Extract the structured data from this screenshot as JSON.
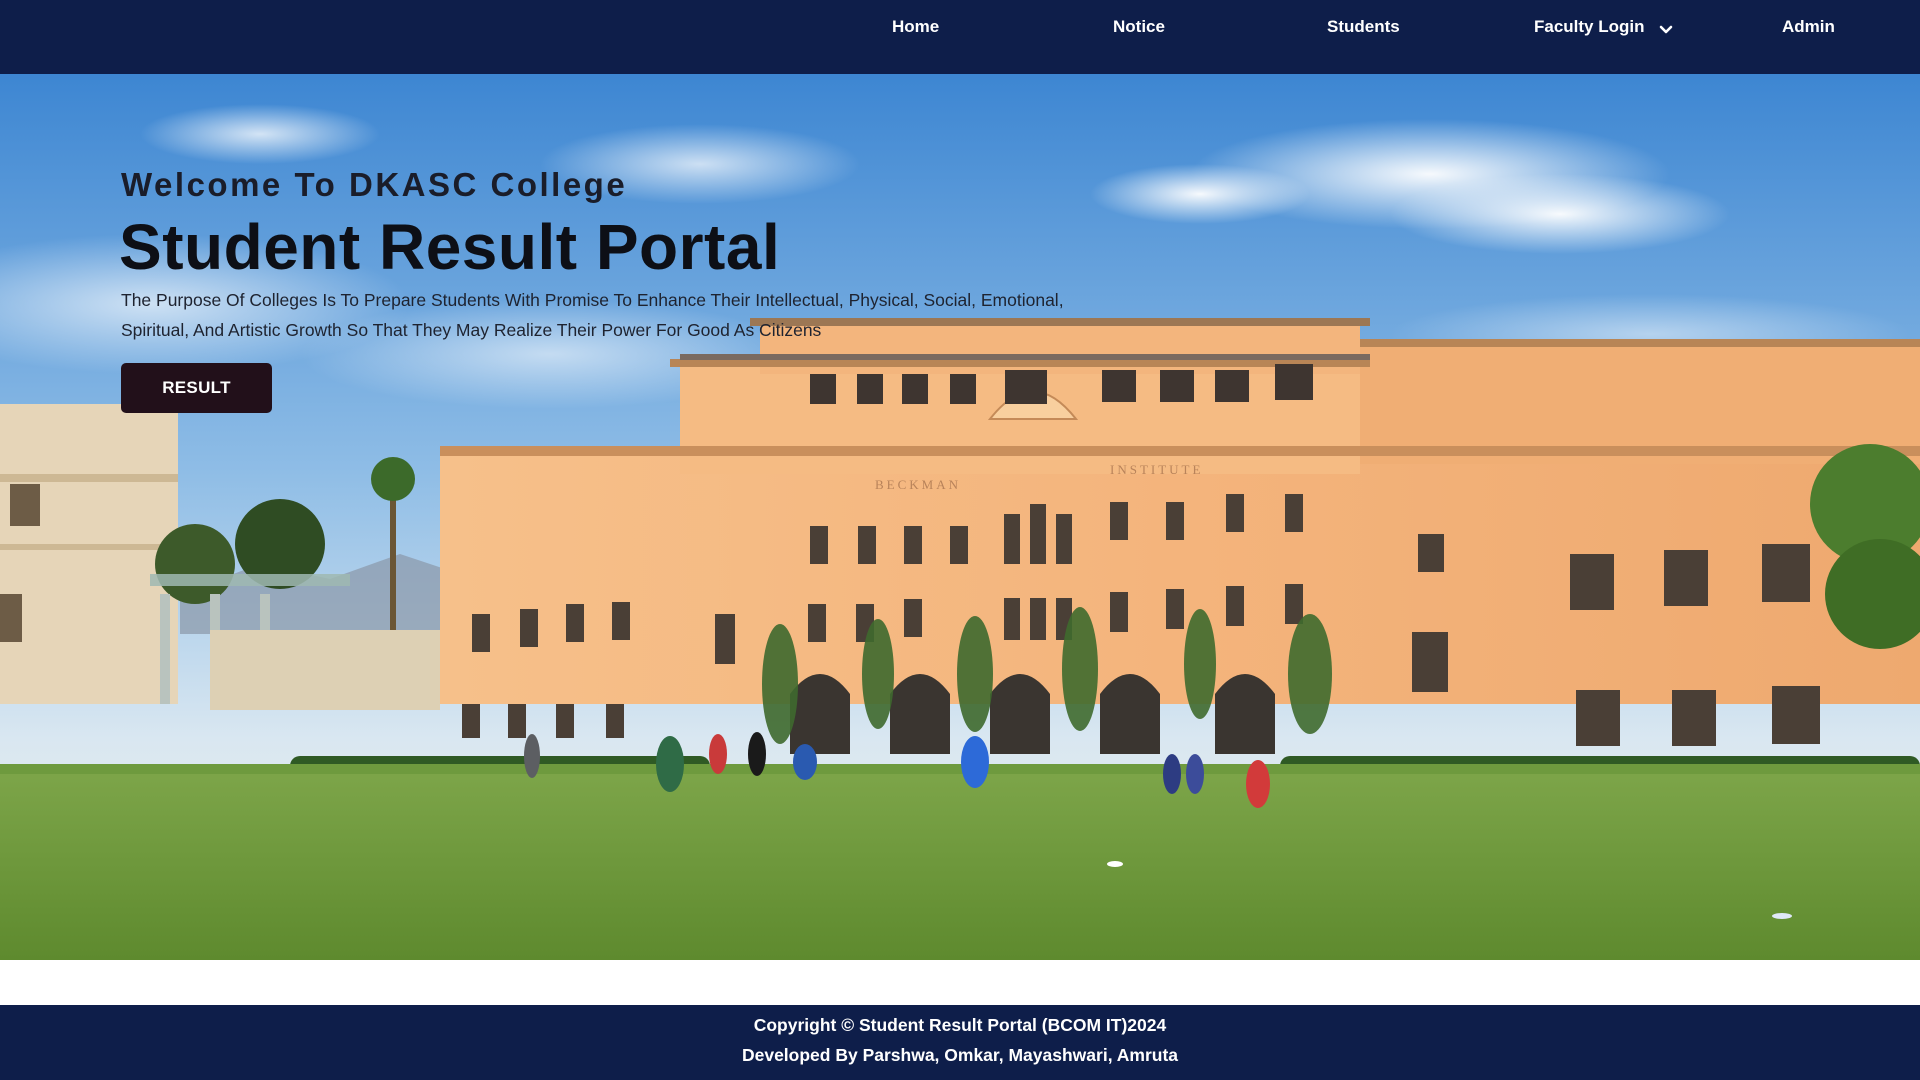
{
  "navbar": {
    "items": [
      {
        "label": "Home"
      },
      {
        "label": "Notice"
      },
      {
        "label": "Students"
      },
      {
        "label": "Faculty Login",
        "has_dropdown": true,
        "icon": "chevron-down-icon"
      },
      {
        "label": "Admin"
      }
    ]
  },
  "hero": {
    "welcome": "Welcome To DKASC College",
    "title": "Student Result Portal",
    "description": "The Purpose Of Colleges Is To Prepare Students With Promise To Enhance Their Intellectual, Physical, Social, Emotional, Spiritual, And Artistic Growth So That They May Realize Their Power For Good As Citizens",
    "button_label": "RESULT",
    "building_sign": "BECKMAN INSTITUTE"
  },
  "footer": {
    "copyright": "Copyright © Student Result Portal (BCOM IT)2024",
    "developed_by": "Developed By Parshwa, Omkar, Mayashwari, Amruta"
  },
  "colors": {
    "navbar_bg": "#0e1e4a",
    "footer_bg": "#0e1e4a",
    "button_bg": "#22101a",
    "sky_top": "#4a90d6",
    "building": "#f3b27a",
    "lawn": "#6f9a3a"
  }
}
